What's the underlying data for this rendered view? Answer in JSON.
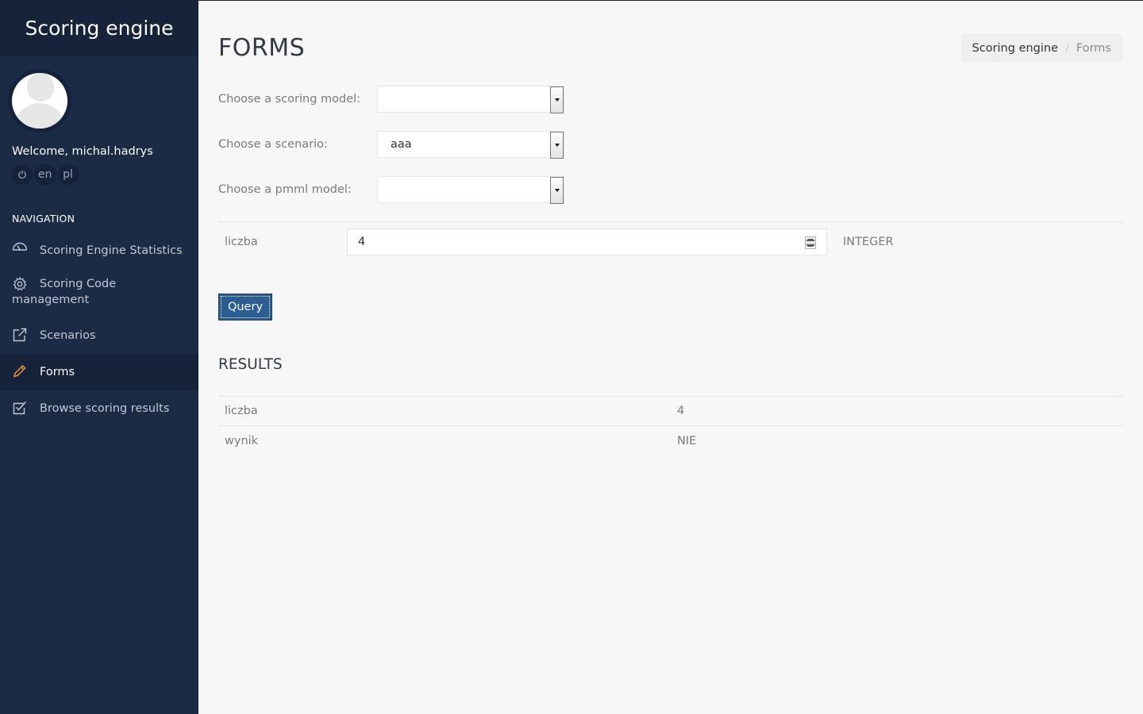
{
  "app": {
    "brand": "Scoring engine"
  },
  "user": {
    "welcome": "Welcome, michal.hadrys",
    "lang_en": "en",
    "lang_pl": "pl",
    "power_icon": "power-icon"
  },
  "sidebar": {
    "heading": "NAVIGATION",
    "items": [
      {
        "label": "Scoring Engine Statistics",
        "icon": "dashboard-icon",
        "active": false
      },
      {
        "label": "Scoring Code management",
        "icon": "gear-icon",
        "active": false
      },
      {
        "label": "Scenarios",
        "icon": "external-link-icon",
        "active": false
      },
      {
        "label": "Forms",
        "icon": "pencil-icon",
        "active": true
      },
      {
        "label": "Browse scoring results",
        "icon": "checkbox-icon",
        "active": false
      }
    ]
  },
  "page": {
    "title": "FORMS",
    "breadcrumb": {
      "root": "Scoring engine",
      "separator": "/",
      "current": "Forms"
    }
  },
  "form": {
    "scoring_model": {
      "label": "Choose a scoring model:",
      "value": ""
    },
    "scenario": {
      "label": "Choose a scenario:",
      "value": "aaa"
    },
    "pmml_model": {
      "label": "Choose a pmml model:",
      "value": ""
    },
    "param": {
      "name": "liczba",
      "value": "4",
      "type": "INTEGER"
    },
    "query_label": "Query"
  },
  "results": {
    "title": "RESULTS",
    "rows": [
      {
        "key": "liczba",
        "value": "4"
      },
      {
        "key": "wynik",
        "value": "NIE"
      }
    ]
  },
  "colors": {
    "sidebar_bg": "#1b2a45",
    "brand_bg": "#16233b",
    "active_item_bg": "#15223a",
    "accent_orange": "#e8923a",
    "button_blue": "#2b5d93",
    "main_bg": "#f7f7f7"
  }
}
